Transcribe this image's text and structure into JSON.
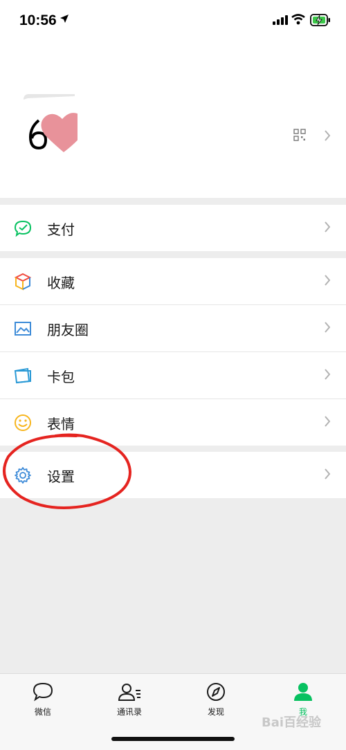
{
  "status_bar": {
    "time": "10:56"
  },
  "profile": {
    "qr_icon": "qr-code-icon"
  },
  "menu": {
    "group1": [
      {
        "label": "支付",
        "icon": "pay-icon",
        "color": "#07c160"
      }
    ],
    "group2": [
      {
        "label": "收藏",
        "icon": "favorites-cube-icon"
      },
      {
        "label": "朋友圈",
        "icon": "moments-image-icon"
      },
      {
        "label": "卡包",
        "icon": "card-wallet-icon"
      },
      {
        "label": "表情",
        "icon": "sticker-smile-icon"
      }
    ],
    "group3": [
      {
        "label": "设置",
        "icon": "gear-icon",
        "color": "#3d8bd8"
      }
    ]
  },
  "tabbar": {
    "tabs": [
      {
        "label": "微信",
        "icon": "chat-bubble-icon",
        "active": false
      },
      {
        "label": "通讯录",
        "icon": "contacts-icon",
        "active": false
      },
      {
        "label": "发现",
        "icon": "compass-icon",
        "active": false
      },
      {
        "label": "我",
        "icon": "person-icon",
        "active": true
      }
    ],
    "active_color": "#07c160"
  },
  "annotation_color": "#e52420",
  "watermark": "Bai百经验"
}
